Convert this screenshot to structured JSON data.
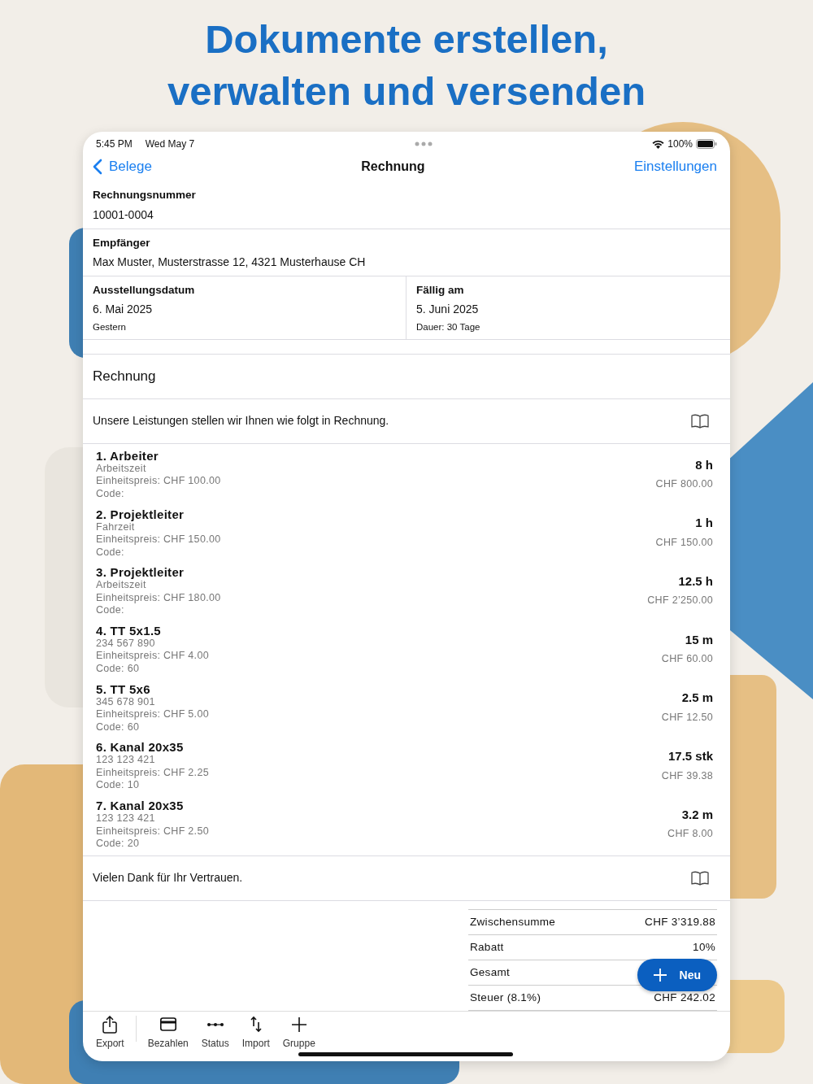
{
  "headline": [
    "Dokumente erstellen,",
    "verwalten und versenden"
  ],
  "status_bar": {
    "time": "5:45 PM",
    "date": "Wed May 7",
    "battery": "100%"
  },
  "nav": {
    "back": "Belege",
    "title": "Rechnung",
    "action": "Einstellungen"
  },
  "fields": [
    {
      "label": "Rechnungsnummer",
      "value": "10001-0004"
    },
    {
      "label": "Empfänger",
      "value": "Max Muster, Musterstrasse 12, 4321 Musterhause CH"
    }
  ],
  "dates": [
    {
      "label": "Ausstellungsdatum",
      "value": "6. Mai 2025",
      "note": "Gestern"
    },
    {
      "label": "Fällig am",
      "value": "5. Juni 2025",
      "note": "Dauer: 30 Tage"
    }
  ],
  "section_title": "Rechnung",
  "intro_text": "Unsere Leistungen stellen wir Ihnen wie folgt in Rechnung.",
  "items": [
    {
      "title": "1. Arbeiter",
      "lines": [
        "Arbeitszeit",
        "Einheitspreis: CHF 100.00",
        "Code:"
      ],
      "quantity": "8 h",
      "amount": "CHF 800.00"
    },
    {
      "title": "2. Projektleiter",
      "lines": [
        "Fahrzeit",
        "Einheitspreis: CHF 150.00",
        "Code:"
      ],
      "quantity": "1 h",
      "amount": "CHF 150.00"
    },
    {
      "title": "3. Projektleiter",
      "lines": [
        "Arbeitszeit",
        "Einheitspreis: CHF 180.00",
        "Code:"
      ],
      "quantity": "12.5 h",
      "amount": "CHF 2’250.00"
    },
    {
      "title": "4. TT 5x1.5",
      "lines": [
        "234 567 890",
        "Einheitspreis: CHF 4.00",
        "Code: 60"
      ],
      "quantity": "15 m",
      "amount": "CHF 60.00"
    },
    {
      "title": "5. TT 5x6",
      "lines": [
        "345 678 901",
        "Einheitspreis: CHF 5.00",
        "Code: 60"
      ],
      "quantity": "2.5 m",
      "amount": "CHF 12.50"
    },
    {
      "title": "6. Kanal 20x35",
      "lines": [
        "123 123 421",
        "Einheitspreis: CHF 2.25",
        "Code: 10"
      ],
      "quantity": "17.5 stk",
      "amount": "CHF 39.38"
    },
    {
      "title": "7. Kanal 20x35",
      "lines": [
        "123 123 421",
        "Einheitspreis: CHF 2.50",
        "Code: 20"
      ],
      "quantity": "3.2 m",
      "amount": "CHF 8.00"
    }
  ],
  "footer_text": "Vielen Dank für Ihr Vertrauen.",
  "totals": [
    {
      "label": "Zwischensumme",
      "value": "CHF 3’319.88"
    },
    {
      "label": "Rabatt",
      "value": "10%"
    },
    {
      "label": "Gesamt"
    },
    {
      "label": "Steuer (8.1%)",
      "value": "CHF 242.02"
    }
  ],
  "fab": {
    "label": "Neu"
  },
  "toolbar": [
    {
      "label": "Export",
      "kind": "share"
    },
    {
      "label": "Bezahlen",
      "kind": "card"
    },
    {
      "label": "Status",
      "kind": "dots"
    },
    {
      "label": "Import",
      "kind": "arrows"
    },
    {
      "label": "Gruppe",
      "kind": "plus"
    }
  ]
}
